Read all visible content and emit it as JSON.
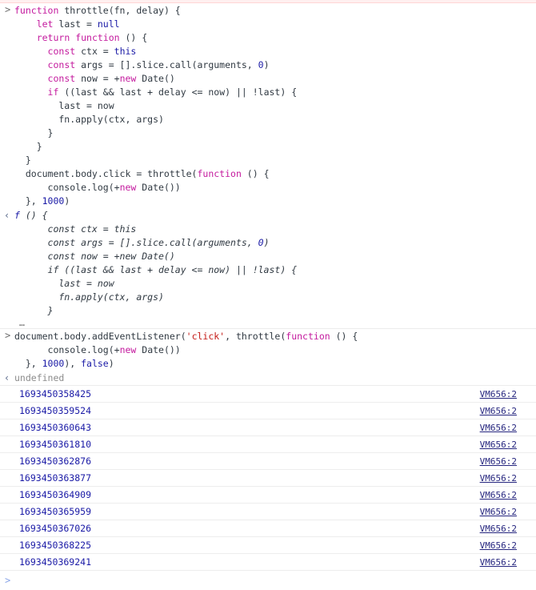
{
  "window": {
    "app": "Chrome DevTools Console",
    "panel": "Console"
  },
  "markers": {
    "input_prompt": ">",
    "output_prompt": "‹",
    "live_prompt": ">",
    "expand_ellipsis": "…"
  },
  "colors": {
    "keyword": "#c41a9e",
    "literal": "#1a1aa6",
    "string": "#c41a16",
    "undefined": "#8c8c8c",
    "source_link": "#26267f",
    "divider": "#ededed",
    "error_strip": "#fff0f0",
    "live_prompt": "#8ba6e8"
  },
  "entries": [
    {
      "kind": "input",
      "name": "console-input-throttle-definition",
      "lines": [
        "function throttle(fn, delay) {",
        "    let last = null",
        "    return function () {",
        "      const ctx = this",
        "      const args = [].slice.call(arguments, 0)",
        "      const now = +new Date()",
        "      if ((last && last + delay <= now) || !last) {",
        "        last = now",
        "        fn.apply(ctx, args)",
        "      }",
        "    }",
        "  }",
        "  document.body.click = throttle(function () {",
        "      console.log(+new Date())",
        "  }, 1000)"
      ]
    },
    {
      "kind": "output",
      "name": "console-output-function-value",
      "lines": [
        "f () {",
        "      const ctx = this",
        "      const args = [].slice.call(arguments, 0)",
        "      const now = +new Date()",
        "      if ((last && last + delay <= now) || !last) {",
        "        last = now",
        "        fn.apply(ctx, args)",
        "      }"
      ],
      "truncated": true
    },
    {
      "kind": "input",
      "name": "console-input-addeventlistener",
      "lines": [
        "document.body.addEventListener('click', throttle(function () {",
        "      console.log(+new Date())",
        "  }, 1000), false)"
      ]
    },
    {
      "kind": "output",
      "name": "console-output-undefined",
      "lines": [
        "undefined"
      ]
    }
  ],
  "logs": {
    "source_label": "VM656:2",
    "rows": [
      {
        "value": "1693450358425",
        "source": "VM656:2"
      },
      {
        "value": "1693450359524",
        "source": "VM656:2"
      },
      {
        "value": "1693450360643",
        "source": "VM656:2"
      },
      {
        "value": "1693450361810",
        "source": "VM656:2"
      },
      {
        "value": "1693450362876",
        "source": "VM656:2"
      },
      {
        "value": "1693450363877",
        "source": "VM656:2"
      },
      {
        "value": "1693450364909",
        "source": "VM656:2"
      },
      {
        "value": "1693450365959",
        "source": "VM656:2"
      },
      {
        "value": "1693450367026",
        "source": "VM656:2"
      },
      {
        "value": "1693450368225",
        "source": "VM656:2"
      },
      {
        "value": "1693450369241",
        "source": "VM656:2"
      }
    ]
  }
}
